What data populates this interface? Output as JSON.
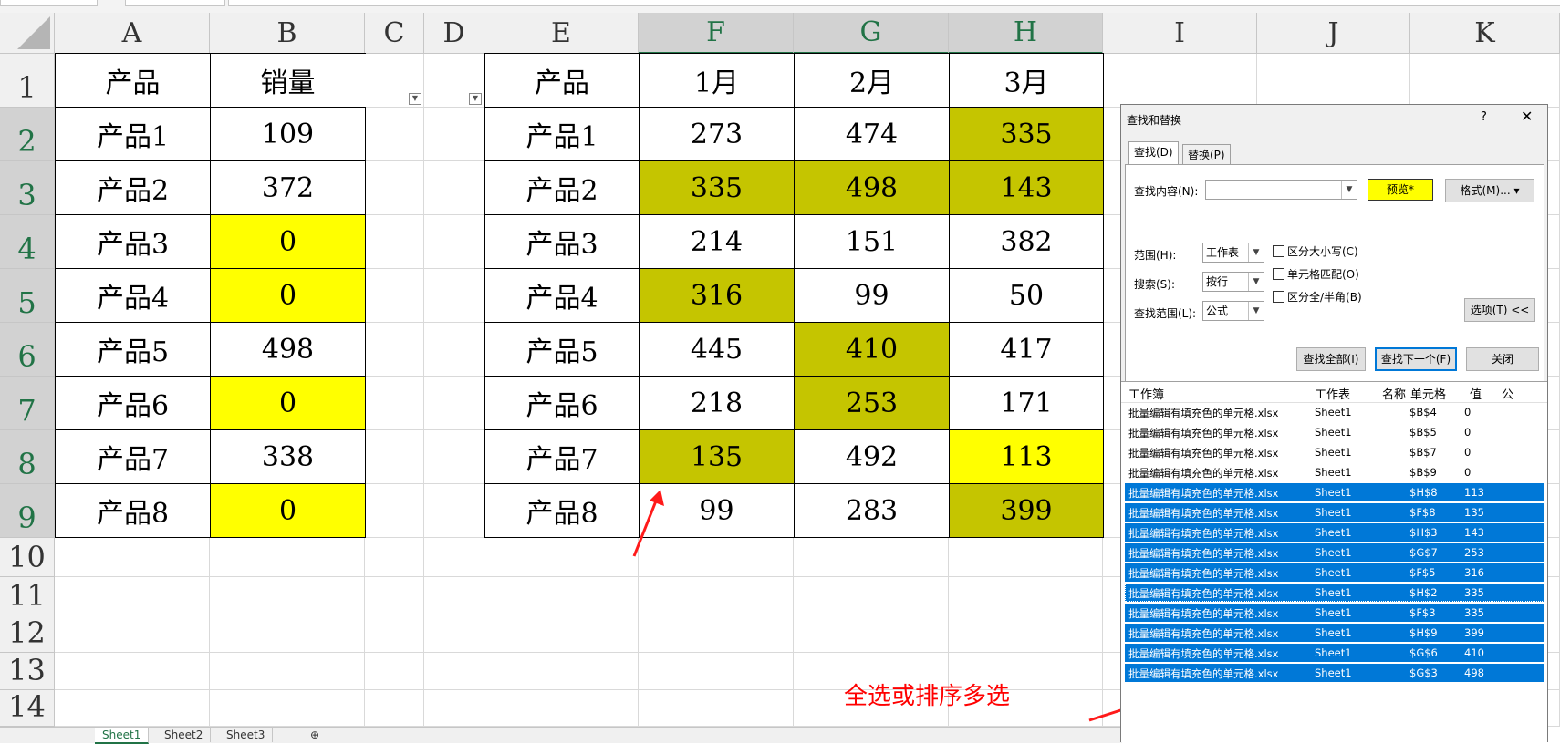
{
  "columns": [
    "A",
    "B",
    "C",
    "D",
    "E",
    "F",
    "G",
    "H",
    "I",
    "J",
    "K"
  ],
  "rows": [
    "1",
    "2",
    "3",
    "4",
    "5",
    "6",
    "7",
    "8",
    "9",
    "10",
    "11",
    "12",
    "13",
    "14"
  ],
  "table1": {
    "headers": [
      "产品",
      "销量"
    ],
    "products": [
      "产品1",
      "产品2",
      "产品3",
      "产品4",
      "产品5",
      "产品6",
      "产品7",
      "产品8"
    ],
    "sales": [
      "109",
      "372",
      "0",
      "0",
      "498",
      "0",
      "338",
      "0"
    ]
  },
  "table2": {
    "headers": [
      "产品",
      "1月",
      "2月",
      "3月"
    ],
    "rows": [
      [
        "产品1",
        "273",
        "474",
        "335"
      ],
      [
        "产品2",
        "335",
        "498",
        "143"
      ],
      [
        "产品3",
        "214",
        "151",
        "382"
      ],
      [
        "产品4",
        "316",
        "99",
        "50"
      ],
      [
        "产品5",
        "445",
        "410",
        "417"
      ],
      [
        "产品6",
        "218",
        "253",
        "171"
      ],
      [
        "产品7",
        "135",
        "492",
        "113"
      ],
      [
        "产品8",
        "99",
        "283",
        "399"
      ]
    ]
  },
  "colors": {
    "yellow": "#ffff00",
    "olive": "#c5c500",
    "selection": "#0078d7",
    "header_selected": "#217346",
    "annotation": "#ff0000"
  },
  "sheet_tabs": [
    "Sheet1",
    "Sheet2",
    "Sheet3"
  ],
  "add_sheet_icon": "plus-circle-icon",
  "dialog": {
    "title": "查找和替换",
    "help": "?",
    "close_icon": "✕",
    "tab_find": "查找(D)",
    "tab_replace": "替换(P)",
    "find_what_label": "查找内容(N):",
    "find_what_value": "",
    "preview": "预览*",
    "format_button": "格式(M)...",
    "within_label": "范围(H):",
    "within_value": "工作表",
    "search_label": "搜索(S):",
    "search_value": "按行",
    "lookin_label": "查找范围(L):",
    "lookin_value": "公式",
    "match_case": "区分大小写(C)",
    "match_entire": "单元格匹配(O)",
    "match_byte": "区分全/半角(B)",
    "options_button": "选项(T) <<",
    "find_all": "查找全部(I)",
    "find_next": "查找下一个(F)",
    "close": "关闭",
    "results_headers": [
      "工作簿",
      "工作表",
      "名称",
      "单元格",
      "值",
      "公"
    ],
    "results": [
      {
        "book": "批量编辑有填充色的单元格.xlsx",
        "sheet": "Sheet1",
        "cell": "$B$4",
        "value": "0",
        "selected": false
      },
      {
        "book": "批量编辑有填充色的单元格.xlsx",
        "sheet": "Sheet1",
        "cell": "$B$5",
        "value": "0",
        "selected": false
      },
      {
        "book": "批量编辑有填充色的单元格.xlsx",
        "sheet": "Sheet1",
        "cell": "$B$7",
        "value": "0",
        "selected": false
      },
      {
        "book": "批量编辑有填充色的单元格.xlsx",
        "sheet": "Sheet1",
        "cell": "$B$9",
        "value": "0",
        "selected": false
      },
      {
        "book": "批量编辑有填充色的单元格.xlsx",
        "sheet": "Sheet1",
        "cell": "$H$8",
        "value": "113",
        "selected": true
      },
      {
        "book": "批量编辑有填充色的单元格.xlsx",
        "sheet": "Sheet1",
        "cell": "$F$8",
        "value": "135",
        "selected": true
      },
      {
        "book": "批量编辑有填充色的单元格.xlsx",
        "sheet": "Sheet1",
        "cell": "$H$3",
        "value": "143",
        "selected": true
      },
      {
        "book": "批量编辑有填充色的单元格.xlsx",
        "sheet": "Sheet1",
        "cell": "$G$7",
        "value": "253",
        "selected": true
      },
      {
        "book": "批量编辑有填充色的单元格.xlsx",
        "sheet": "Sheet1",
        "cell": "$F$5",
        "value": "316",
        "selected": true
      },
      {
        "book": "批量编辑有填充色的单元格.xlsx",
        "sheet": "Sheet1",
        "cell": "$H$2",
        "value": "335",
        "selected": true
      },
      {
        "book": "批量编辑有填充色的单元格.xlsx",
        "sheet": "Sheet1",
        "cell": "$F$3",
        "value": "335",
        "selected": true
      },
      {
        "book": "批量编辑有填充色的单元格.xlsx",
        "sheet": "Sheet1",
        "cell": "$H$9",
        "value": "399",
        "selected": true
      },
      {
        "book": "批量编辑有填充色的单元格.xlsx",
        "sheet": "Sheet1",
        "cell": "$G$6",
        "value": "410",
        "selected": true
      },
      {
        "book": "批量编辑有填充色的单元格.xlsx",
        "sheet": "Sheet1",
        "cell": "$G$3",
        "value": "498",
        "selected": true
      }
    ]
  },
  "annotation": "全选或排序多选"
}
